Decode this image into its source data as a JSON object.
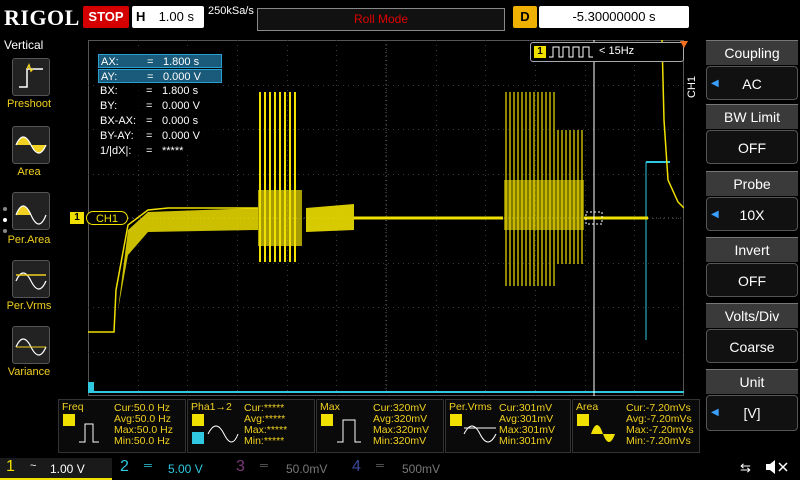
{
  "topbar": {
    "brand": "RIGOL",
    "run_state": "STOP",
    "timebase_label": "H",
    "timebase_value": "1.00 s",
    "sample_rate": "250kSa/s",
    "mode": "Roll Mode",
    "delay_label": "D",
    "delay_value": "-5.30000000 s"
  },
  "leftpanel": {
    "title": "Vertical",
    "items": [
      {
        "label": "Preshoot",
        "icon": "preshoot-icon"
      },
      {
        "label": "Area",
        "icon": "area-icon"
      },
      {
        "label": "Per.Area",
        "icon": "per-area-icon"
      },
      {
        "label": "Per.Vrms",
        "icon": "per-vrms-icon"
      },
      {
        "label": "Variance",
        "icon": "variance-icon"
      }
    ]
  },
  "cursor_table": [
    {
      "key": "AX:",
      "eq": "=",
      "val": "1.800 s",
      "highlight": true
    },
    {
      "key": "AY:",
      "eq": "=",
      "val": "0.000 V",
      "highlight": true
    },
    {
      "key": "BX:",
      "eq": "=",
      "val": "1.800 s",
      "highlight": false
    },
    {
      "key": "BY:",
      "eq": "=",
      "val": "0.000 V",
      "highlight": false
    },
    {
      "key": "BX-AX:",
      "eq": "=",
      "val": "0.000 s",
      "highlight": false
    },
    {
      "key": "BY-AY:",
      "eq": "=",
      "val": "0.000 V",
      "highlight": false
    },
    {
      "key": "1/|dX|:",
      "eq": "=",
      "val": "*****",
      "highlight": false
    }
  ],
  "trigger": {
    "channel": "1",
    "info": "< 15Hz"
  },
  "channel_marker": {
    "num": "1",
    "label": "CH1"
  },
  "right_side_label": "CH1",
  "rightpanel": [
    {
      "head": "Coupling",
      "value": "AC"
    },
    {
      "head": "BW Limit",
      "value": "OFF"
    },
    {
      "head": "Probe",
      "value": "10X"
    },
    {
      "head": "Invert",
      "value": "OFF"
    },
    {
      "head": "Volts/Div",
      "value": "Coarse"
    },
    {
      "head": "Unit",
      "value": "[V]"
    }
  ],
  "measurements": [
    {
      "title": "Freq",
      "cur": "Cur:50.0 Hz",
      "avg": "Avg:50.0 Hz",
      "max": "Max:50.0 Hz",
      "min": "Min:50.0 Hz"
    },
    {
      "title": "Pha1→2",
      "cur": "Cur:*****",
      "avg": "Avg:*****",
      "max": "Max:*****",
      "min": "Min:*****"
    },
    {
      "title": "Max",
      "cur": "Cur:320mV",
      "avg": "Avg:320mV",
      "max": "Max:320mV",
      "min": "Min:320mV"
    },
    {
      "title": "Per.Vrms",
      "cur": "Cur:301mV",
      "avg": "Avg:301mV",
      "max": "Max:301mV",
      "min": "Min:301mV"
    },
    {
      "title": "Area",
      "cur": "Cur:-7.20mVs",
      "avg": "Avg:-7.20mVs",
      "max": "Max:-7.20mVs",
      "min": "Min:-7.20mVs"
    }
  ],
  "channels": [
    {
      "num": "1",
      "scale": "1.00 V",
      "color": "#f0e000",
      "active": true
    },
    {
      "num": "2",
      "scale": "5.00 V",
      "color": "#30c8e0",
      "active": false
    },
    {
      "num": "3",
      "scale": "50.0mV",
      "color": "#c050c0",
      "active": false
    },
    {
      "num": "4",
      "scale": "500mV",
      "color": "#3070ff",
      "active": false
    }
  ],
  "colors": {
    "ch1": "#f0e000",
    "ch2": "#30c8e0",
    "stop": "#d40000",
    "mode_text": "#e00000"
  }
}
